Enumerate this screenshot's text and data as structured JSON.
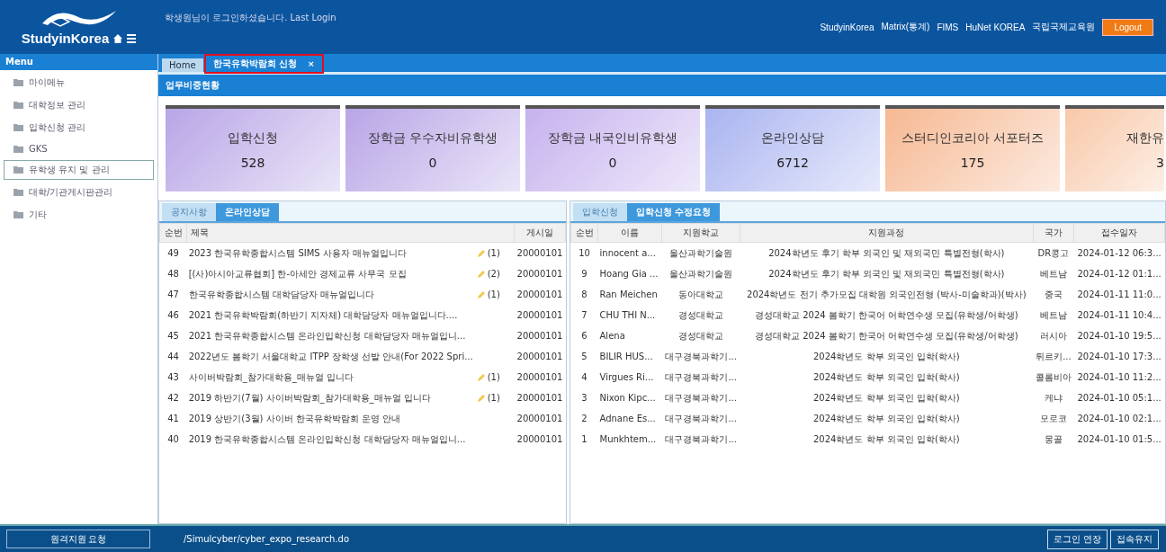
{
  "header": {
    "logo": "StudyinKorea",
    "login_message": "학생원님이 로그인하셨습니다. Last Login",
    "links": [
      "StudyinKorea",
      "Matrix(통계)",
      "FIMS",
      "HuNet KOREA",
      "국립국제교육원"
    ],
    "logout": "Logout"
  },
  "sidebar": {
    "title": "Menu",
    "items": [
      {
        "label": "마이메뉴",
        "selected": false
      },
      {
        "label": "대학정보 관리",
        "selected": false
      },
      {
        "label": "입학신청 관리",
        "selected": false
      },
      {
        "label": "GKS",
        "selected": false
      },
      {
        "label": "유학생 유치 및 관리",
        "selected": true
      },
      {
        "label": "대학/기관게시판관리",
        "selected": false
      },
      {
        "label": "기타",
        "selected": false
      }
    ]
  },
  "tabs": [
    {
      "label": "Home",
      "selected": false
    },
    {
      "label": "한국유학박람회 신청",
      "selected": true,
      "close": "×"
    }
  ],
  "section_title": "업무비중현황",
  "cards": [
    {
      "label": "입학신청",
      "value": "528",
      "color": "#b8a5e6"
    },
    {
      "label": "장학금 우수자비유학생",
      "value": "0",
      "color": "#b8a5e6"
    },
    {
      "label": "장학금 내국인비유학생",
      "value": "0",
      "color": "#c6b2ee"
    },
    {
      "label": "온라인상담",
      "value": "6712",
      "color": "#aab4f0"
    },
    {
      "label": "스터디인코리아 서포터즈",
      "value": "175",
      "color": "#f6b892"
    },
    {
      "label": "재한유",
      "value": "3",
      "color": "#f8c8a8"
    }
  ],
  "notice_panel": {
    "tabs": [
      {
        "label": "공지사항",
        "selected": false
      },
      {
        "label": "온라인상담",
        "selected": true
      }
    ],
    "columns": [
      "순번",
      "제목",
      "게시일"
    ],
    "rows": [
      {
        "no": "49",
        "title": "2023 한국유학종합시스템 SIMS 사용자 매뉴얼입니다",
        "count": "(1)",
        "date": "20000101"
      },
      {
        "no": "48",
        "title": "[(사)아시아교류협회] 한-아세안 경제교류 사무국 모집",
        "count": "(2)",
        "date": "20000101"
      },
      {
        "no": "47",
        "title": "한국유학종합시스템 대학담당자 매뉴얼입니다",
        "count": "(1)",
        "date": "20000101"
      },
      {
        "no": "46",
        "title": "2021 한국유학박람회(하반기 지자체) 대학담당자 매뉴얼입니다....",
        "date": "20000101"
      },
      {
        "no": "45",
        "title": "2021 한국유학종합시스템 온라인입학신청 대학담당자 매뉴얼입니...",
        "date": "20000101"
      },
      {
        "no": "44",
        "title": "2022년도 봄학기 서울대학교 ITPP 장학생 선발 안내(For 2022 Spri...",
        "date": "20000101"
      },
      {
        "no": "43",
        "title": "사이버박람회_참가대학용_매뉴얼 입니다",
        "count": "(1)",
        "date": "20000101"
      },
      {
        "no": "42",
        "title": "2019 하반기(7월) 사이버박람회_참가대학용_매뉴얼 입니다",
        "count": "(1)",
        "date": "20000101"
      },
      {
        "no": "41",
        "title": "2019 상반기(3월) 사이버 한국유학박람회 운영 안내",
        "date": "20000101"
      },
      {
        "no": "40",
        "title": "2019 한국유학종합시스템 온라인입학신청 대학담당자 매뉴얼입니...",
        "date": "20000101"
      }
    ]
  },
  "application_panel": {
    "tabs": [
      {
        "label": "입학신청",
        "selected": false
      },
      {
        "label": "입학신청 수정요청",
        "selected": true
      }
    ],
    "columns": [
      "순번",
      "이름",
      "지원학교",
      "지원과정",
      "국가",
      "접수일자"
    ],
    "rows": [
      [
        "10",
        "innocent a...",
        "울산과학기술원",
        "2024학년도 후기 학부 외국인 및 재외국민 특별전형(학사)",
        "DR콩고",
        "2024-01-12 06:3..."
      ],
      [
        "9",
        "Hoang Gia ...",
        "울산과학기술원",
        "2024학년도 후기 학부 외국인 및 재외국민 특별전형(학사)",
        "베트남",
        "2024-01-12 01:1..."
      ],
      [
        "8",
        "Ran Meichen",
        "동아대학교",
        "2024학년도 전기 추가모집 대학원 외국인전형 (박사-미술학과)(박사)",
        "중국",
        "2024-01-11 11:0..."
      ],
      [
        "7",
        "CHU THI N...",
        "경성대학교",
        "경성대학교 2024 봄학기 한국어 어학연수생 모집(유학생/어학생)",
        "베트남",
        "2024-01-11 10:4..."
      ],
      [
        "6",
        "Alena",
        "경성대학교",
        "경성대학교 2024 봄학기 한국어 어학연수생 모집(유학생/어학생)",
        "러시아",
        "2024-01-10 19:5..."
      ],
      [
        "5",
        "BILIR HUS...",
        "대구경북과학기...",
        "2024학년도 학부 외국인 입학(학사)",
        "튀르키...",
        "2024-01-10 17:3..."
      ],
      [
        "4",
        "Virgues Ri...",
        "대구경북과학기...",
        "2024학년도 학부 외국인 입학(학사)",
        "콜롬비아",
        "2024-01-10 11:2..."
      ],
      [
        "3",
        "Nixon Kipc...",
        "대구경북과학기...",
        "2024학년도 학부 외국인 입학(학사)",
        "케냐",
        "2024-01-10 05:1..."
      ],
      [
        "2",
        "Adnane Es...",
        "대구경북과학기...",
        "2024학년도 학부 외국인 입학(학사)",
        "모로코",
        "2024-01-10 02:1..."
      ],
      [
        "1",
        "Munkhtem...",
        "대구경북과학기...",
        "2024학년도 학부 외국인 입학(학사)",
        "몽골",
        "2024-01-10 01:5..."
      ]
    ]
  },
  "footer": {
    "remote_support": "원격지원 요청",
    "path": "/Simulcyber/cyber_expo_research.do",
    "buttons": [
      "로그인 연장",
      "접속유지"
    ]
  }
}
